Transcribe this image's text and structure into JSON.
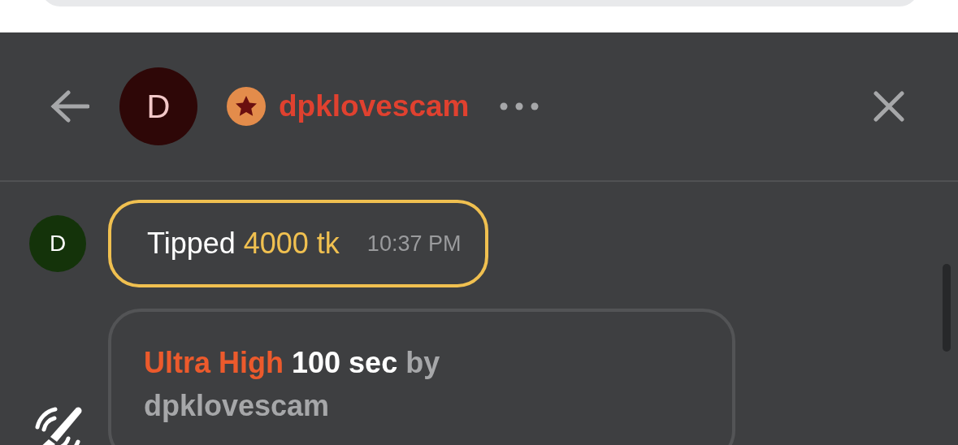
{
  "header": {
    "avatar_letter": "D",
    "username": "dpklovescam"
  },
  "messages": [
    {
      "kind": "tip",
      "avatar_letter": "D",
      "text": "Tipped",
      "amount": "4000 tk",
      "time": "10:37 PM"
    },
    {
      "kind": "vibe",
      "level": "Ultra High",
      "duration": "100 sec",
      "by": "by",
      "user": "dpklovescam"
    }
  ]
}
